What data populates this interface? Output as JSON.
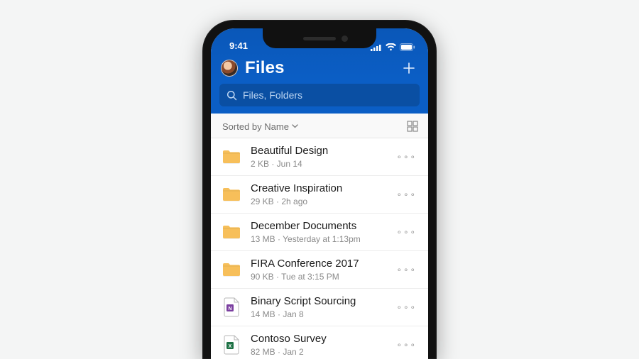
{
  "status": {
    "time": "9:41"
  },
  "header": {
    "title": "Files",
    "add_label": "+"
  },
  "search": {
    "placeholder": "Files, Folders"
  },
  "sort": {
    "label": "Sorted by Name"
  },
  "files": [
    {
      "icon": "folder",
      "name": "Beautiful Design",
      "meta": "2 KB · Jun 14"
    },
    {
      "icon": "folder",
      "name": "Creative Inspiration",
      "meta": "29 KB · 2h ago"
    },
    {
      "icon": "folder",
      "name": "December Documents",
      "meta": "13 MB · Yesterday at 1:13pm"
    },
    {
      "icon": "folder",
      "name": "FIRA Conference 2017",
      "meta": "90 KB · Tue at 3:15 PM"
    },
    {
      "icon": "onenote",
      "name": "Binary Script Sourcing",
      "meta": "14 MB · Jan 8"
    },
    {
      "icon": "excel",
      "name": "Contoso Survey",
      "meta": "82 MB · Jan 2"
    }
  ],
  "colors": {
    "brand": "#0b5ec5",
    "folder": "#f7bf5a",
    "onenote": "#7b3fa0",
    "excel": "#1f7246"
  }
}
